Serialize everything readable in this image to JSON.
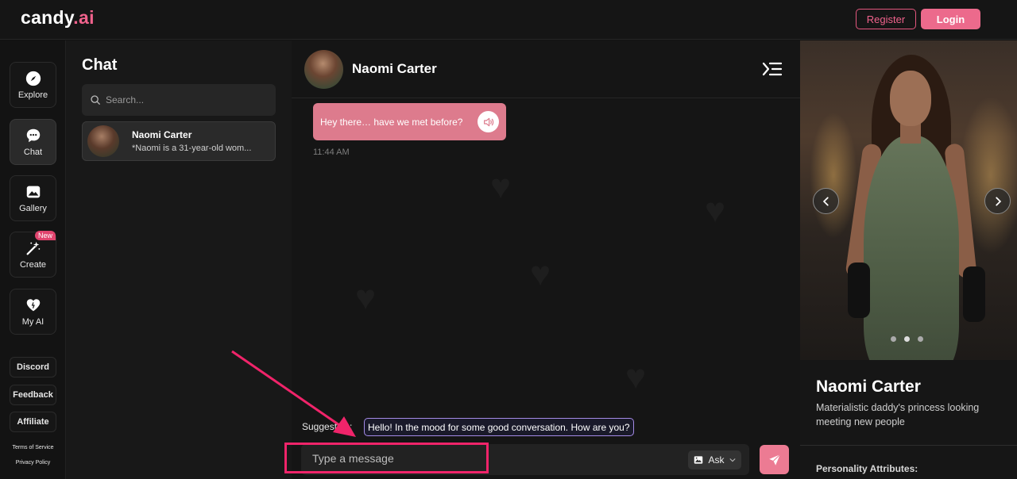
{
  "header": {
    "logo_main": "candy",
    "logo_suffix": ".ai",
    "register_label": "Register",
    "login_label": "Login"
  },
  "nav": {
    "items": [
      {
        "label": "Explore",
        "icon": "compass-icon"
      },
      {
        "label": "Chat",
        "icon": "chat-bubble-icon",
        "active": true
      },
      {
        "label": "Gallery",
        "icon": "gallery-icon"
      },
      {
        "label": "Create",
        "icon": "magic-wand-icon",
        "badge": "New"
      },
      {
        "label": "My AI",
        "icon": "heart-icon"
      }
    ],
    "links": [
      "Discord",
      "Feedback",
      "Affiliate"
    ],
    "terms": "Terms of Service",
    "privacy": "Privacy Policy"
  },
  "chatlist": {
    "title": "Chat",
    "search_placeholder": "Search...",
    "items": [
      {
        "name": "Naomi Carter",
        "preview": "*Naomi is a 31-year-old wom..."
      }
    ]
  },
  "conversation": {
    "name": "Naomi Carter",
    "messages": [
      {
        "text": "Hey there… have we met before?",
        "time": "11:44 AM"
      }
    ],
    "suggestion_label": "Suggestion:",
    "suggestion_text": "Hello! In the mood for some good conversation. How are you?",
    "input_placeholder": "Type a message",
    "ask_label": "Ask"
  },
  "profile": {
    "name": "Naomi Carter",
    "description": "Materialistic daddy's princess looking meeting new people",
    "attributes_label": "Personality Attributes:"
  },
  "colors": {
    "accent": "#ec6a8c",
    "bubble": "#dd7b8d",
    "annotation": "#f0246a"
  }
}
